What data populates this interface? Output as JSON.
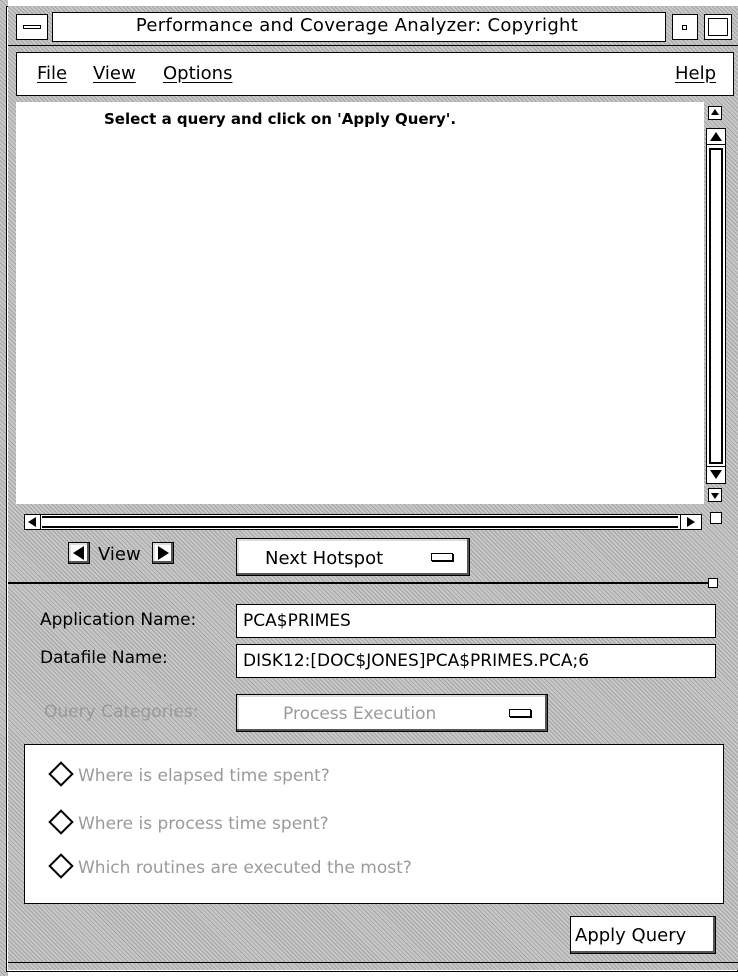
{
  "window": {
    "title": "Performance and Coverage Analyzer: Copyright"
  },
  "menubar": {
    "file": "File",
    "view": "View",
    "options": "Options",
    "help": "Help"
  },
  "content": {
    "message": "Select a query and click on 'Apply Query'."
  },
  "navigation": {
    "view_label": "View",
    "next_hotspot_label": "Next Hotspot"
  },
  "form": {
    "application_name_label": "Application Name:",
    "application_name_value": "PCA$PRIMES",
    "datafile_name_label": "Datafile Name:",
    "datafile_name_value": "DISK12:[DOC$JONES]PCA$PRIMES.PCA;6",
    "query_categories_label": "Query Categories:",
    "query_categories_value": "Process Execution"
  },
  "queries": [
    {
      "label": "Where is elapsed time spent?"
    },
    {
      "label": "Where is process time spent?"
    },
    {
      "label": "Which routines are executed the most?"
    }
  ],
  "actions": {
    "apply_query_label": "Apply Query"
  }
}
